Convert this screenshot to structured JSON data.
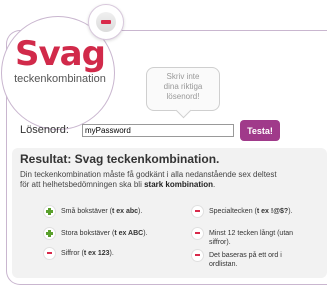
{
  "logo": {
    "title": "Svag",
    "subtitle": "teckenkombination"
  },
  "tooltip": {
    "line1": "Skriv inte",
    "line2": "dina riktiga",
    "line3": "lösenord!"
  },
  "password": {
    "label": "Lösenord:",
    "value": "myPassword",
    "button": "Testa!"
  },
  "result": {
    "title": "Resultat: Svag teckenkombination.",
    "desc_line1": "Din teckenkombination måste få godkänt i alla nedanstående sex deltest",
    "desc_line2_prefix": "för att helhetsbedömningen ska bli ",
    "desc_line2_bold": "stark kombination",
    "desc_line2_suffix": "."
  },
  "criteria": [
    {
      "text_pre": "Små bokstäver (",
      "text_bold": "t ex abc",
      "text_post": ").",
      "status": "pass"
    },
    {
      "text_pre": "Stora bokstäver (",
      "text_bold": "t ex ABC",
      "text_post": ").",
      "status": "pass"
    },
    {
      "text_pre": "Siffror (",
      "text_bold": "t ex 123",
      "text_post": ").",
      "status": "fail"
    },
    {
      "text_pre": "Specialtecken (",
      "text_bold": "t ex !@$?",
      "text_post": ").",
      "status": "fail"
    },
    {
      "text_pre": "Minst 12 tecken långt (utan",
      "text_bold": "",
      "text_post": "siffror).",
      "status": "fail"
    },
    {
      "text_pre": "Det baseras på ett ord i",
      "text_bold": "",
      "text_post": "ordlistan.",
      "status": "fail"
    }
  ],
  "colors": {
    "brand": "#d12a4a",
    "button": "#a03a8a",
    "pass": "#5aa02c",
    "fail": "#d92a4b"
  }
}
